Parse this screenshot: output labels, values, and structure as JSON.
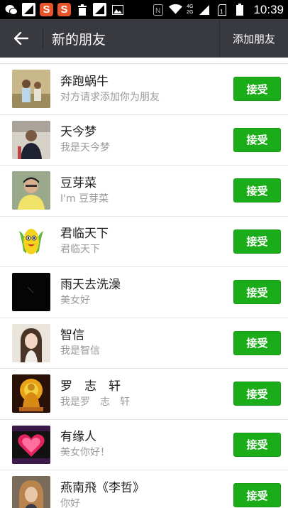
{
  "status_bar": {
    "time": "10:39",
    "network_top": "4G",
    "network_bottom": "2G",
    "icons": [
      "wechat-icon",
      "photo-icon",
      "s-app-icon",
      "s-app-icon",
      "trash-icon",
      "photo-icon",
      "image-icon",
      "nfc-icon",
      "wifi-icon",
      "signal-icon",
      "sim-icon",
      "battery-icon"
    ]
  },
  "header": {
    "title": "新的朋友",
    "action_label": "添加朋友",
    "back_icon": "back-arrow-icon",
    "bar_color": "#393a3f"
  },
  "accept_color": "#1aad19",
  "requests": [
    {
      "name": "奔跑蜗牛",
      "message": "对方请求添加你为朋友",
      "button": "接受"
    },
    {
      "name": "天今梦",
      "message": "我是天今梦",
      "button": "接受"
    },
    {
      "name": "豆芽菜",
      "message": "I'm 豆芽菜",
      "button": "接受"
    },
    {
      "name": "君临天下",
      "message": "君临天下",
      "button": "接受"
    },
    {
      "name": "雨天去洗澡",
      "message": "美女好",
      "button": "接受"
    },
    {
      "name": "智信",
      "message": "我是智信",
      "button": "接受"
    },
    {
      "name": "罗　志　轩",
      "message": "我是罗　志　轩",
      "button": "接受"
    },
    {
      "name": "有缘人",
      "message": "美女你好！",
      "button": "接受"
    },
    {
      "name": "燕南飛《李哲》",
      "message": "你好",
      "button": "接受"
    }
  ]
}
